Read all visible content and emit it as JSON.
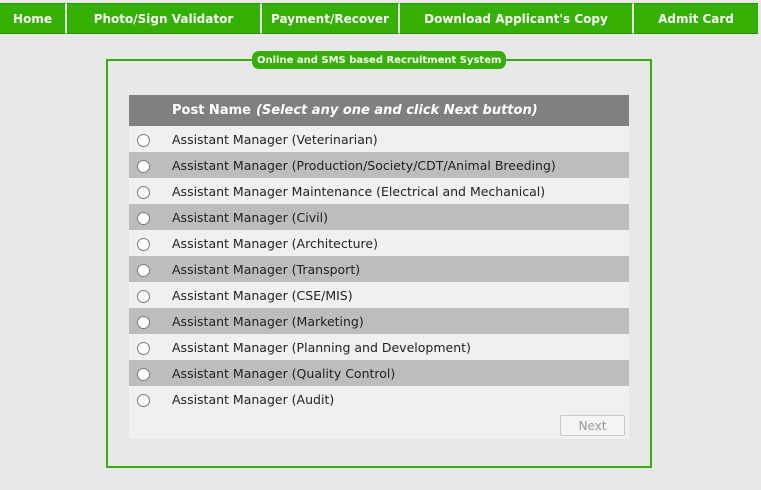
{
  "nav": [
    {
      "label": "Home"
    },
    {
      "label": "Photo/Sign Validator"
    },
    {
      "label": "Payment/Recover"
    },
    {
      "label": "Download Applicant's Copy"
    },
    {
      "label": "Admit Card"
    }
  ],
  "legend": "Online and SMS based Recruitment System",
  "table": {
    "header": "Post Name",
    "hint": "(Select any one and click Next button)",
    "posts": [
      "Assistant Manager (Veterinarian)",
      "Assistant Manager (Production/Society/CDT/Animal Breeding)",
      "Assistant Manager Maintenance (Electrical and Mechanical)",
      "Assistant Manager (Civil)",
      "Assistant Manager (Architecture)",
      "Assistant Manager (Transport)",
      "Assistant Manager (CSE/MIS)",
      "Assistant Manager (Marketing)",
      "Assistant Manager (Planning and Development)",
      "Assistant Manager (Quality Control)",
      "Assistant Manager (Audit)"
    ]
  },
  "next_label": "Next"
}
